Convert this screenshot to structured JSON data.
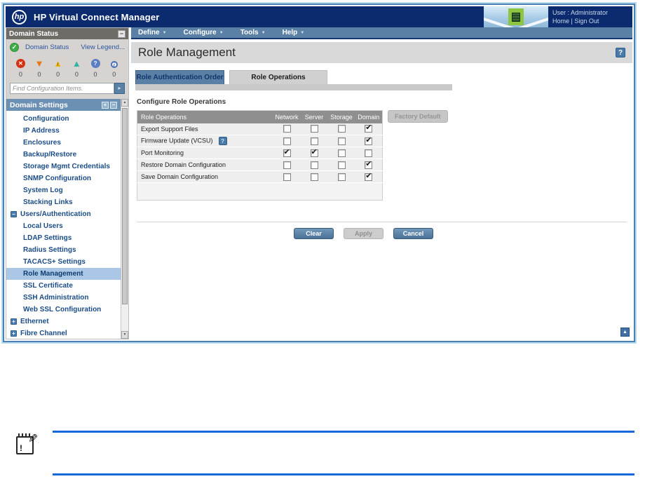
{
  "header": {
    "logo_text": "hp",
    "title": "HP Virtual Connect Manager",
    "user_label": "User : Administrator",
    "home_label": "Home",
    "link_separator": "|",
    "sign_out_label": "Sign Out"
  },
  "menu": {
    "items": [
      {
        "label": "Define"
      },
      {
        "label": "Configure"
      },
      {
        "label": "Tools"
      },
      {
        "label": "Help"
      }
    ]
  },
  "sidebar": {
    "domain_status": {
      "title": "Domain Status",
      "status_link": "Domain Status",
      "legend_link": "View Legend...",
      "indicators": [
        {
          "name": "critical",
          "shape": "circle",
          "color": "#d43212",
          "glyph": "✕",
          "count": "0"
        },
        {
          "name": "major",
          "shape": "triangle-down",
          "color": "#e87815",
          "glyph": "",
          "count": "0"
        },
        {
          "name": "minor",
          "shape": "triangle-up",
          "color": "#f0b400",
          "glyph": "!",
          "count": "0"
        },
        {
          "name": "normal",
          "shape": "triangle-up",
          "color": "#2fb3a5",
          "glyph": "",
          "count": "0"
        },
        {
          "name": "unknown",
          "shape": "circle",
          "color": "#5a7fc4",
          "glyph": "?",
          "count": "0"
        },
        {
          "name": "info",
          "shape": "circle-outline",
          "color": "#4a6fb8",
          "glyph": "i",
          "count": "0"
        }
      ],
      "search_placeholder": "Find Configuration Items."
    },
    "domain_settings": {
      "title": "Domain Settings",
      "items": [
        {
          "label": "Configuration",
          "level": 1
        },
        {
          "label": "IP Address",
          "level": 1
        },
        {
          "label": "Enclosures",
          "level": 1
        },
        {
          "label": "Backup/Restore",
          "level": 1
        },
        {
          "label": "Storage Mgmt Credentials",
          "level": 1
        },
        {
          "label": "SNMP Configuration",
          "level": 1
        },
        {
          "label": "System Log",
          "level": 1
        },
        {
          "label": "Stacking Links",
          "level": 1
        },
        {
          "label": "Users/Authentication",
          "level": 0,
          "expander": "collapse"
        },
        {
          "label": "Local Users",
          "level": 1
        },
        {
          "label": "LDAP Settings",
          "level": 1
        },
        {
          "label": "Radius Settings",
          "level": 1
        },
        {
          "label": "TACACS+ Settings",
          "level": 1
        },
        {
          "label": "Role Management",
          "level": 1,
          "selected": true
        },
        {
          "label": "SSL Certificate",
          "level": 1
        },
        {
          "label": "SSH Administration",
          "level": 1
        },
        {
          "label": "Web SSL Configuration",
          "level": 1
        },
        {
          "label": "Ethernet",
          "level": 0,
          "expander": "expand"
        },
        {
          "label": "Fibre Channel",
          "level": 0,
          "expander": "expand"
        }
      ]
    }
  },
  "main": {
    "page_title": "Role Management",
    "tabs": [
      {
        "label": "Role Authentication Order",
        "active": false
      },
      {
        "label": "Role Operations",
        "active": true
      }
    ],
    "section_title": "Configure Role Operations",
    "table": {
      "columns": [
        "Role Operations",
        "Network",
        "Server",
        "Storage",
        "Domain"
      ],
      "factory_default_label": "Factory Default",
      "rows": [
        {
          "label": "Export Support Files",
          "help": false,
          "checks": [
            false,
            false,
            false,
            true
          ]
        },
        {
          "label": "Firmware Update (VCSU)",
          "help": true,
          "checks": [
            false,
            false,
            false,
            true
          ]
        },
        {
          "label": "Port Monitoring",
          "help": false,
          "checks": [
            true,
            true,
            false,
            false
          ]
        },
        {
          "label": "Restore Domain Configuration",
          "help": false,
          "checks": [
            false,
            false,
            false,
            true
          ]
        },
        {
          "label": "Save Domain Configuration",
          "help": false,
          "checks": [
            false,
            false,
            false,
            true
          ]
        }
      ]
    },
    "buttons": {
      "clear": "Clear",
      "apply": "Apply",
      "cancel": "Cancel"
    }
  },
  "icons": {
    "caret": "▼",
    "minimize": "−",
    "expand": "+",
    "collapse": "−",
    "help": "?",
    "check": "✔",
    "ok_check": "✓",
    "search_go": "▸",
    "scroll_up": "▲",
    "scroll_down": "▼",
    "top": "▲",
    "pencil": "✎",
    "note_mark": "!"
  },
  "colors": {
    "header_navy": "#0b2b6e",
    "menu_steel": "#5b80a5",
    "accent_blue": "#4a7aa8",
    "selected_item": "#aac8e6",
    "rule_blue": "#1668dc"
  }
}
